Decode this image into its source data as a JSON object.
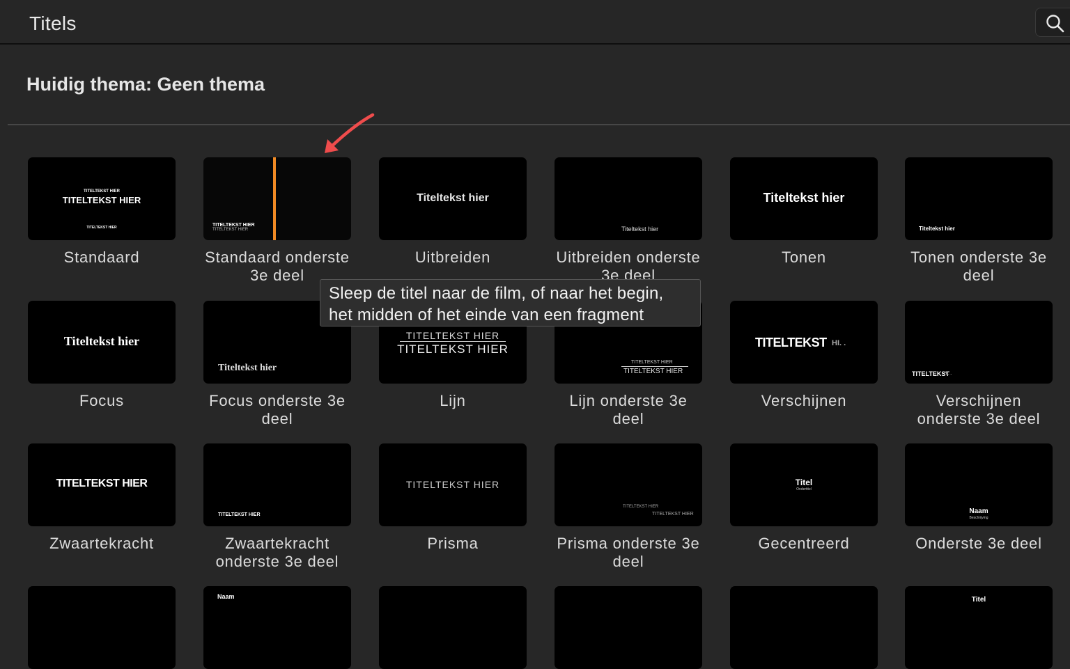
{
  "header": {
    "title": "Titels",
    "search_icon": "magnifier-icon"
  },
  "theme": {
    "label": "Huidig thema: Geen thema"
  },
  "tooltip": {
    "line1": "Sleep de titel naar de film, of naar het begin,",
    "line2": "het midden of het einde van een fragment"
  },
  "tiles": [
    {
      "label_1": "Standaard",
      "label_2": "",
      "preview_main": "TITELTEKST HIER",
      "preview_small": "TITELTEKST HIER",
      "preview_sub": "TITELTEKST HIER"
    },
    {
      "label_1": "Standaard onderste",
      "label_2": "3e deel",
      "preview_main": "TITELTEKST HIER",
      "preview_sub": "TITELTEKST HIER",
      "accent_color": "#f08a24"
    },
    {
      "label_1": "Uitbreiden",
      "label_2": "",
      "preview_main": "Titeltekst hier"
    },
    {
      "label_1": "Uitbreiden onderste",
      "label_2": "3e deel",
      "preview_main": "Titeltekst hier"
    },
    {
      "label_1": "Tonen",
      "label_2": "",
      "preview_main": "Titeltekst hier"
    },
    {
      "label_1": "Tonen onderste 3e",
      "label_2": "deel",
      "preview_main": "Titeltekst hier"
    },
    {
      "label_1": "Focus",
      "label_2": "",
      "preview_main": "Titeltekst hier"
    },
    {
      "label_1": "Focus onderste 3e",
      "label_2": "deel",
      "preview_main": "Titeltekst hier"
    },
    {
      "label_1": "Lijn",
      "label_2": "",
      "preview_main": "TITELTEKST HIER",
      "preview_sub": "TITELTEKST HIER"
    },
    {
      "label_1": "Lijn onderste 3e",
      "label_2": "deel",
      "preview_main": "TITELTEKST HIER",
      "preview_sub": "TITELTEKST HIER"
    },
    {
      "label_1": "Verschijnen",
      "label_2": "",
      "preview_main": "TITELTEKST",
      "preview_sub": "HI. ."
    },
    {
      "label_1": "Verschijnen",
      "label_2": "onderste 3e deel",
      "preview_main": "TITELTEKST",
      "preview_sub": "HI. ."
    },
    {
      "label_1": "Zwaartekracht",
      "label_2": "",
      "preview_main": "TITELTEKST HIER"
    },
    {
      "label_1": "Zwaartekracht",
      "label_2": "onderste 3e deel",
      "preview_main": "TITELTEKST HIER"
    },
    {
      "label_1": "Prisma",
      "label_2": "",
      "preview_main": "TITELTEKST HIER"
    },
    {
      "label_1": "Prisma onderste 3e",
      "label_2": "deel",
      "preview_main": "TITELTEKST HIER",
      "preview_sub": "TITELTEKST HIER"
    },
    {
      "label_1": "Gecentreerd",
      "label_2": "",
      "preview_main": "Titel",
      "preview_sub": "Ondertitel"
    },
    {
      "label_1": "Onderste 3e deel",
      "label_2": "",
      "preview_main": "Naam",
      "preview_sub": "Beschrijving"
    },
    {
      "preview_main": ""
    },
    {
      "preview_main": "Naam"
    },
    {
      "preview_main": ""
    },
    {
      "preview_main": ""
    },
    {
      "preview_main": ""
    },
    {
      "preview_main": "Titel"
    }
  ]
}
